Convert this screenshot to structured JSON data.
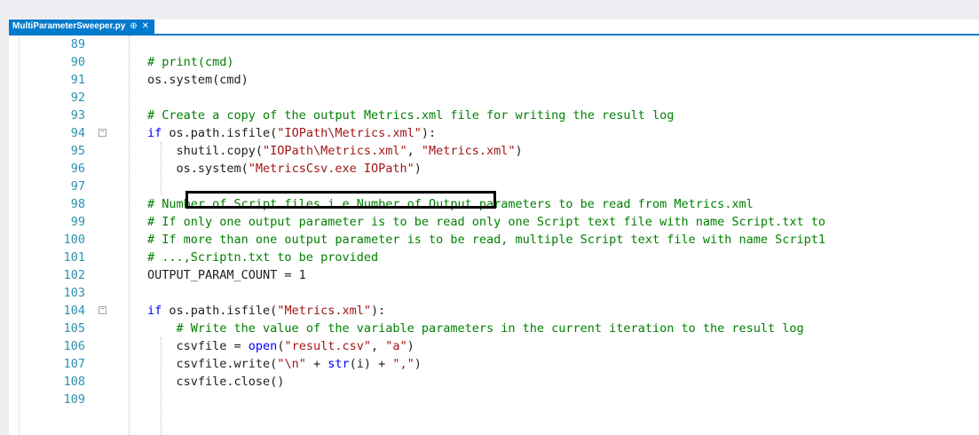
{
  "editor": {
    "tab": {
      "filename": "MultiParameterSweeper.py",
      "pin_glyph": "⊕",
      "close_glyph": "✕"
    },
    "lines": [
      {
        "n": "89",
        "fold": false,
        "tokens": []
      },
      {
        "n": "90",
        "fold": false,
        "tokens": [
          {
            "t": "# print(cmd)",
            "c": "comment"
          }
        ]
      },
      {
        "n": "91",
        "fold": false,
        "tokens": [
          {
            "t": "os.system(cmd)",
            "c": "plain"
          }
        ]
      },
      {
        "n": "92",
        "fold": false,
        "tokens": []
      },
      {
        "n": "93",
        "fold": false,
        "tokens": [
          {
            "t": "# Create a copy of the output Metrics.xml file for writing the result log",
            "c": "comment"
          }
        ]
      },
      {
        "n": "94",
        "fold": true,
        "tokens": [
          {
            "t": "if",
            "c": "keyword"
          },
          {
            "t": " os.path.isfile(",
            "c": "plain"
          },
          {
            "t": "\"IOPath\\Metrics.xml\"",
            "c": "string"
          },
          {
            "t": "):",
            "c": "plain"
          }
        ]
      },
      {
        "n": "95",
        "fold": false,
        "tokens": [
          {
            "t": "    shutil.copy(",
            "c": "plain"
          },
          {
            "t": "\"IOPath\\Metrics.xml\"",
            "c": "string"
          },
          {
            "t": ", ",
            "c": "plain"
          },
          {
            "t": "\"Metrics.xml\"",
            "c": "string"
          },
          {
            "t": ")",
            "c": "plain"
          }
        ]
      },
      {
        "n": "96",
        "fold": false,
        "tokens": [
          {
            "t": "    os.system(",
            "c": "plain"
          },
          {
            "t": "\"MetricsCsv.exe IOPath\"",
            "c": "string"
          },
          {
            "t": ")",
            "c": "plain"
          }
        ]
      },
      {
        "n": "97",
        "fold": false,
        "tokens": []
      },
      {
        "n": "98",
        "fold": false,
        "tokens": [
          {
            "t": "# Number of Script files i.e Number of Output parameters to be read from Metrics.xml",
            "c": "comment"
          }
        ]
      },
      {
        "n": "99",
        "fold": false,
        "tokens": [
          {
            "t": "# If only one output parameter is to be read only one Script text file with name Script.txt to",
            "c": "comment"
          }
        ]
      },
      {
        "n": "100",
        "fold": false,
        "tokens": [
          {
            "t": "# If more than one output parameter is to be read, multiple Script text file with name Script1",
            "c": "comment"
          }
        ]
      },
      {
        "n": "101",
        "fold": false,
        "tokens": [
          {
            "t": "# ...,Scriptn.txt to be provided",
            "c": "comment"
          }
        ]
      },
      {
        "n": "102",
        "fold": false,
        "tokens": [
          {
            "t": "OUTPUT_PARAM_COUNT = 1",
            "c": "plain"
          }
        ]
      },
      {
        "n": "103",
        "fold": false,
        "tokens": []
      },
      {
        "n": "104",
        "fold": true,
        "tokens": [
          {
            "t": "if",
            "c": "keyword"
          },
          {
            "t": " os.path.isfile(",
            "c": "plain"
          },
          {
            "t": "\"Metrics.xml\"",
            "c": "string"
          },
          {
            "t": "):",
            "c": "plain"
          }
        ]
      },
      {
        "n": "105",
        "fold": false,
        "tokens": [
          {
            "t": "    ",
            "c": "plain"
          },
          {
            "t": "# Write the value of the variable parameters in the current iteration to the result log",
            "c": "comment"
          }
        ]
      },
      {
        "n": "106",
        "fold": false,
        "tokens": [
          {
            "t": "    csvfile = ",
            "c": "plain"
          },
          {
            "t": "open",
            "c": "keyword"
          },
          {
            "t": "(",
            "c": "plain"
          },
          {
            "t": "\"result.csv\"",
            "c": "string"
          },
          {
            "t": ", ",
            "c": "plain"
          },
          {
            "t": "\"a\"",
            "c": "string"
          },
          {
            "t": ")",
            "c": "plain"
          }
        ]
      },
      {
        "n": "107",
        "fold": false,
        "tokens": [
          {
            "t": "    csvfile.write(",
            "c": "plain"
          },
          {
            "t": "\"\\n\"",
            "c": "string"
          },
          {
            "t": " + ",
            "c": "plain"
          },
          {
            "t": "str",
            "c": "keyword"
          },
          {
            "t": "(i) + ",
            "c": "plain"
          },
          {
            "t": "\",\"",
            "c": "string"
          },
          {
            "t": ")",
            "c": "plain"
          }
        ]
      },
      {
        "n": "108",
        "fold": false,
        "tokens": [
          {
            "t": "    csvfile.close()",
            "c": "plain"
          }
        ]
      },
      {
        "n": "109",
        "fold": false,
        "tokens": []
      }
    ],
    "colors": {
      "keyword": "#0000ff",
      "string": "#a31515",
      "comment": "#008000",
      "plain": "#1e1e1e",
      "line_number": "#2b91af",
      "tab_active": "#007acc"
    }
  }
}
